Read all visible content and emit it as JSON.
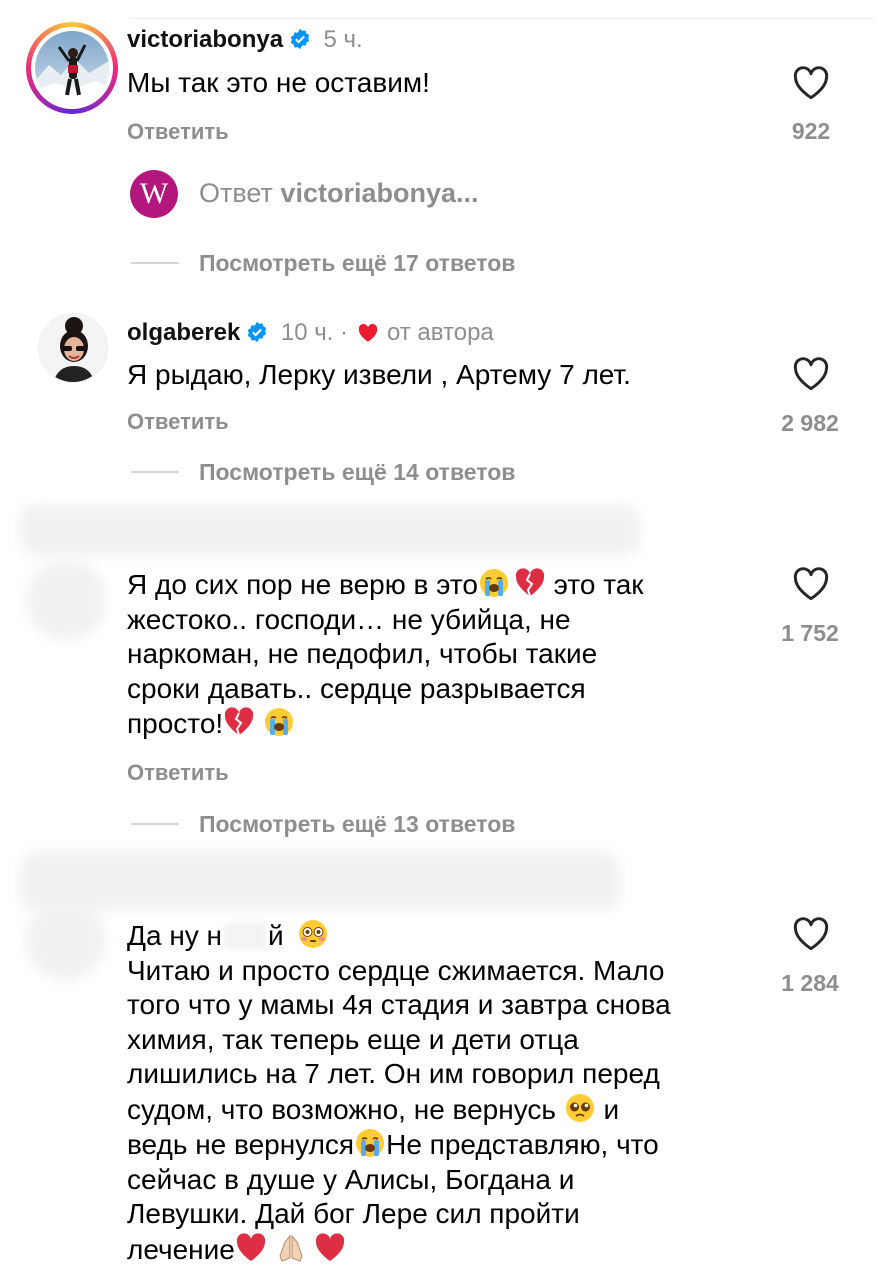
{
  "comments": [
    {
      "username": "victoriabonya",
      "time": "5 ч.",
      "text": "Мы так это не оставим!",
      "reply_label": "Ответить",
      "likes": "922",
      "sub_reply": {
        "avatar_letter": "W",
        "label": "Ответ",
        "username": "victoriabonya..."
      },
      "view_replies": "Посмотреть ещё 17 ответов"
    },
    {
      "username": "olgaberek",
      "time": "10 ч. ·",
      "liked_by_author": "от автора",
      "text": "Я рыдаю, Лерку извели , Артему 7 лет.",
      "reply_label": "Ответить",
      "likes": "2 982",
      "view_replies": "Посмотреть ещё 14 ответов"
    },
    {
      "text_lines": [
        "Я до сих пор не верю в это",
        " это так",
        "жестоко.. господи… не убийца, не",
        "наркоман, не педофил, чтобы такие",
        "сроки давать.. сердце разрывается",
        "просто!"
      ],
      "reply_label": "Ответить",
      "likes": "1 752",
      "view_replies": "Посмотреть ещё 13 ответов"
    },
    {
      "text_first_a": "Да ну н",
      "text_first_b": "й",
      "text_lines": [
        "Читаю и просто сердце сжимается. Мало",
        "того что у мамы 4я стадия и завтра снова",
        "химия, так теперь еще и дети отца",
        "лишились на 7 лет. Он им говорил перед",
        "судом, что возможно, не вернусь",
        "и",
        "ведь не вернулся",
        "Не представляю, что",
        "сейчас в душе у Алисы, Богдана и",
        "Левушки. Дай бог Лере сил пройти",
        "лечение"
      ],
      "likes": "1 284"
    }
  ],
  "icons": {
    "heart": "heart-outline-icon",
    "verified": "verified-badge-icon",
    "red_heart": "red-heart-icon"
  },
  "colors": {
    "verified_blue": "#0095f6",
    "muted": "#8e8e8e",
    "red_heart": "#ed1b2e",
    "w_avatar": "#b3167d"
  }
}
